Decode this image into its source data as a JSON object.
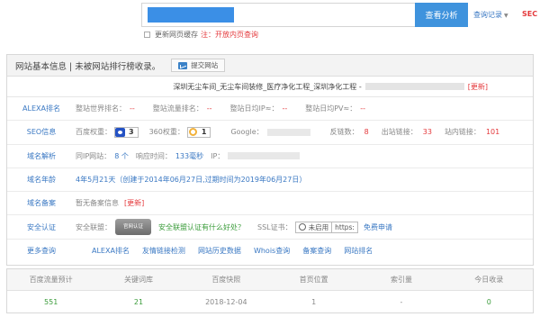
{
  "search": {
    "clear_icon": "x-icon",
    "button_label": "查看分析",
    "record_link": "查询记录",
    "sec_link": "SEC",
    "cache_label": "更新网页缓存",
    "cache_note": "注：开放内页查询"
  },
  "panel": {
    "title": "网站基本信息 | 未被网站排行榜收录。",
    "submit_label": "提交网站",
    "site_title": "深圳无尘车间_无尘车间装修_医疗净化工程_深圳净化工程 -",
    "update_label": "[更新]"
  },
  "rows": {
    "alexa": {
      "label": "ALEXA排名",
      "world_label": "整站世界排名：",
      "world_val": "--",
      "traffic_label": "整站流量排名：",
      "traffic_val": "--",
      "ip_label": "整站日均IP≈：",
      "ip_val": "--",
      "pv_label": "整站日均PV≈：",
      "pv_val": "--"
    },
    "seo": {
      "label": "SEO信息",
      "baidu_label": "百度权重：",
      "baidu_val": "3",
      "s360_label": "360权重：",
      "s360_val": "1",
      "google_label": "Google：",
      "backlink_label": "反链数：",
      "backlink_val": "8",
      "outlink_label": "出站链接：",
      "outlink_val": "33",
      "inlink_label": "站内链接：",
      "inlink_val": "101"
    },
    "dns": {
      "label": "域名解析",
      "sameip_label": "同IP网站：",
      "sameip_val": "8 个",
      "resp_label": "响应时间：",
      "resp_val": "133毫秒",
      "ip_label": "IP："
    },
    "age": {
      "label": "域名年龄",
      "value": "4年5月21天（创建于2014年06月27日,过期时间为2019年06月27日）"
    },
    "beian": {
      "label": "域名备案",
      "text": "暂无备案信息",
      "update": "[更新]"
    },
    "security": {
      "label": "安全认证",
      "union_label": "安全联盟：",
      "seal_text": "官网认证",
      "union_link": "安全联盟认证有什么好处？",
      "ssl_label": "SSL证书：",
      "ssl_status": "未启用",
      "ssl_proto": "https:",
      "free_link": "免费申请"
    },
    "more": {
      "label": "更多查询",
      "links": [
        "ALEXA排名",
        "友情链接检测",
        "网站历史数据",
        "Whois查询",
        "备案查询",
        "网站排名"
      ]
    }
  },
  "stats": {
    "headers": [
      "百度流量预计",
      "关键词库",
      "百度快照",
      "首页位置",
      "索引量",
      "今日收录"
    ],
    "values": [
      "551",
      "21",
      "2018-12-04",
      "1",
      "-",
      "0"
    ]
  },
  "colors": {
    "accent": "#3f93dd",
    "link": "#3a78c3",
    "alert": "#e4393c",
    "good": "#3b9c3b"
  },
  "icons": [
    "x-icon",
    "caret-down-icon",
    "checkbox-icon",
    "submit-site-icon",
    "baidu-paw-icon",
    "360-ring-icon",
    "official-seal-icon",
    "ssl-status-icon"
  ]
}
